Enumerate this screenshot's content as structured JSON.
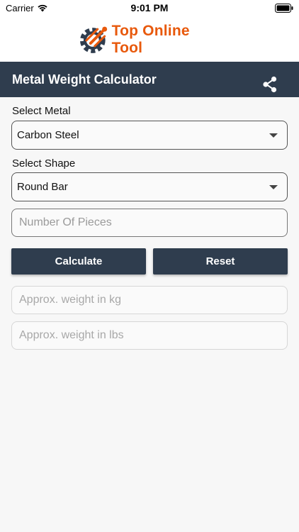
{
  "status_bar": {
    "carrier": "Carrier",
    "time": "9:01 PM"
  },
  "logo": {
    "text": "Top Online Tool",
    "icon": "gear-logo-icon",
    "color": "#e8590c"
  },
  "app_bar": {
    "title": "Metal Weight Calculator",
    "share_icon": "share-icon",
    "background": "#2f3d4e"
  },
  "form": {
    "metal": {
      "label": "Select Metal",
      "selected": "Carbon Steel"
    },
    "shape": {
      "label": "Select Shape",
      "selected": "Round Bar"
    },
    "pieces": {
      "placeholder": "Number Of Pieces",
      "value": ""
    }
  },
  "buttons": {
    "calculate": "Calculate",
    "reset": "Reset"
  },
  "results": {
    "kg_placeholder": "Approx. weight in kg",
    "lbs_placeholder": "Approx. weight in lbs"
  }
}
